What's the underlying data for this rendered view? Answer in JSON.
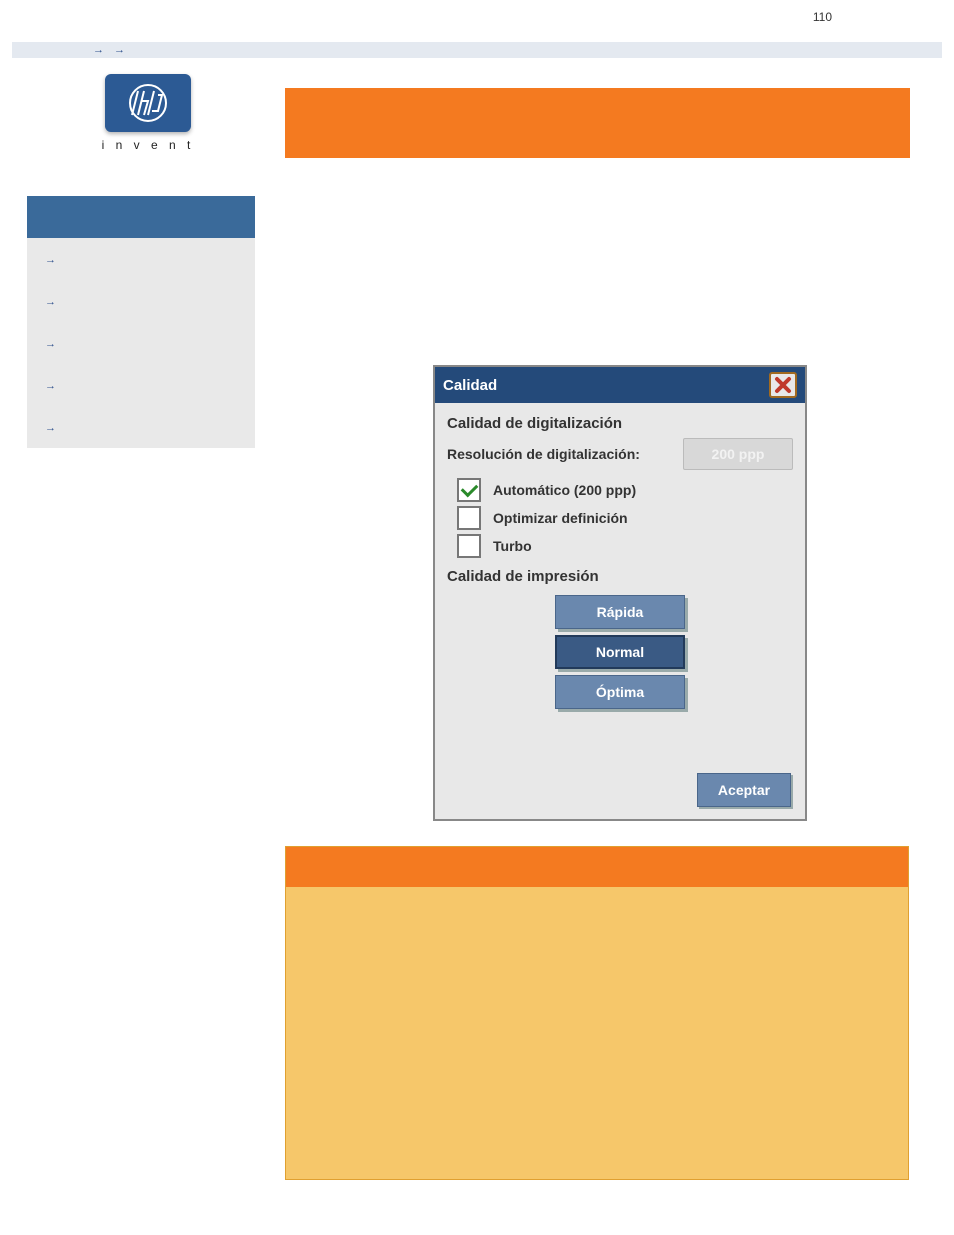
{
  "page_number": "110",
  "breadcrumb": {
    "items": [
      {
        "label": ""
      },
      {
        "label": ""
      },
      {
        "label": ""
      }
    ]
  },
  "logo": {
    "tagline": "i n v e n t"
  },
  "title_band": "",
  "sidebar": {
    "header": "",
    "items": [
      {
        "label": ""
      },
      {
        "label": ""
      },
      {
        "label": ""
      },
      {
        "label": ""
      },
      {
        "label": ""
      }
    ]
  },
  "dialog": {
    "title": "Calidad",
    "scan_quality_group": "Calidad de digitalización",
    "resolution_label": "Resolución de digitalización:",
    "resolution_value": "200 ppp",
    "checks": [
      {
        "label": "Automático (200 ppp)",
        "checked": true
      },
      {
        "label": "Optimizar definición",
        "checked": false
      },
      {
        "label": "Turbo",
        "checked": false
      }
    ],
    "print_quality_group": "Calidad de impresión",
    "quality_buttons": [
      {
        "label": "Rápida",
        "selected": false
      },
      {
        "label": "Normal",
        "selected": true
      },
      {
        "label": "Óptima",
        "selected": false
      }
    ],
    "accept": "Aceptar"
  },
  "note": {
    "header": "",
    "body": ""
  }
}
